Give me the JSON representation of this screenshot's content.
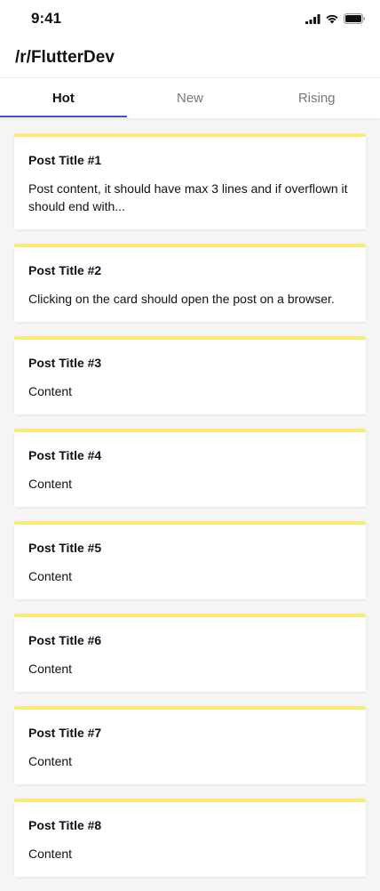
{
  "status_bar": {
    "time": "9:41"
  },
  "app_bar": {
    "title": "/r/FlutterDev"
  },
  "tabs": [
    {
      "label": "Hot",
      "active": true
    },
    {
      "label": "New",
      "active": false
    },
    {
      "label": "Rising",
      "active": false
    }
  ],
  "accent_color": "#3b4fd4",
  "card_border_color": "#fbe97a",
  "posts": [
    {
      "title": "Post Title #1",
      "content": "Post content, it should have max 3 lines and if overflown it should end with..."
    },
    {
      "title": "Post Title #2",
      "content": "Clicking on the card should open the post on a browser."
    },
    {
      "title": "Post Title #3",
      "content": "Content"
    },
    {
      "title": "Post Title #4",
      "content": "Content"
    },
    {
      "title": "Post Title #5",
      "content": "Content"
    },
    {
      "title": "Post Title #6",
      "content": "Content"
    },
    {
      "title": "Post Title #7",
      "content": "Content"
    },
    {
      "title": "Post Title #8",
      "content": "Content"
    }
  ]
}
